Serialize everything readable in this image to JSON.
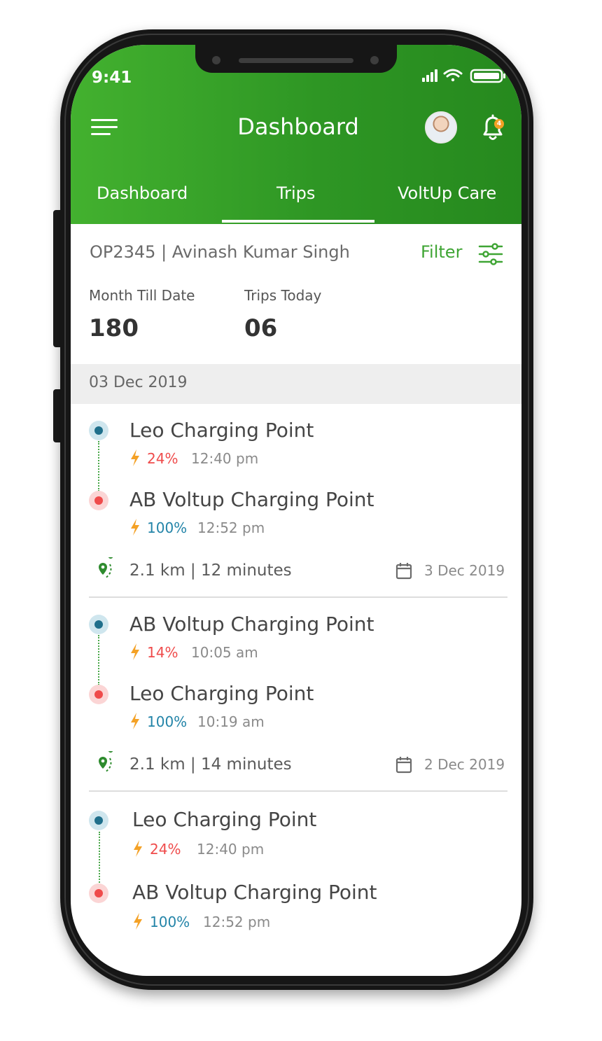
{
  "status_bar": {
    "time": "9:41"
  },
  "header": {
    "title": "Dashboard",
    "notification_count": "4",
    "icons": [
      "menu-icon",
      "avatar",
      "bell-icon"
    ]
  },
  "tabs": [
    {
      "label": "Dashboard",
      "active": false
    },
    {
      "label": "Trips",
      "active": true
    },
    {
      "label": "VoltUp Care",
      "active": false
    }
  ],
  "driver": {
    "info": "OP2345 | Avinash Kumar Singh",
    "filter_label": "Filter"
  },
  "stats": [
    {
      "label": "Month Till Date",
      "value": "180"
    },
    {
      "label": "Trips Today",
      "value": "06"
    }
  ],
  "date_header": "03 Dec 2019",
  "trips": [
    {
      "start": {
        "name": "Leo Charging Point",
        "charge": "24%",
        "time": "12:40 pm"
      },
      "end": {
        "name": "AB Voltup Charging Point",
        "charge": "100%",
        "time": "12:52 pm"
      },
      "summary": "2.1 km | 12 minutes",
      "date": "3 Dec 2019"
    },
    {
      "start": {
        "name": "AB Voltup Charging Point",
        "charge": "14%",
        "time": "10:05 am"
      },
      "end": {
        "name": "Leo Charging Point",
        "charge": "100%",
        "time": "10:19 am"
      },
      "summary": "2.1 km | 14 minutes",
      "date": "2 Dec 2019"
    },
    {
      "start": {
        "name": "Leo Charging Point",
        "charge": "24%",
        "time": "12:40 pm"
      },
      "end": {
        "name": "AB Voltup Charging Point",
        "charge": "100%",
        "time": "12:52 pm"
      }
    }
  ],
  "colors": {
    "brand_green": "#2e9624",
    "low_charge": "#ef4b4b",
    "full_charge": "#2384a8",
    "bolt": "#f4a125"
  }
}
